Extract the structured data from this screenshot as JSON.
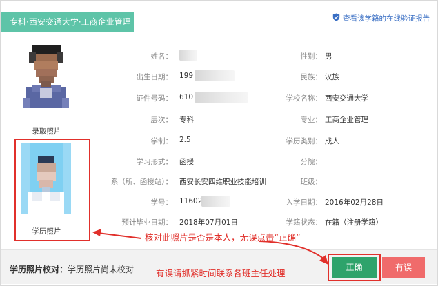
{
  "header": {
    "title": "专科·西安交通大学·工商企业管理",
    "verify_link": "查看该学籍的在线验证报告",
    "link_color": "#3a6fc4",
    "accent_color": "#5ec4a8"
  },
  "photos": {
    "admission_caption": "录取照片",
    "degree_caption": "学历照片"
  },
  "left_fields": [
    {
      "label": "姓名：",
      "value": ""
    },
    {
      "label": "出生日期：",
      "value": "199"
    },
    {
      "label": "证件号码：",
      "value": "610"
    },
    {
      "label": "层次：",
      "value": "专科"
    },
    {
      "label": "学制：",
      "value": "2.5"
    },
    {
      "label": "学习形式：",
      "value": "函授"
    },
    {
      "label": "系（所、函授站）：",
      "value": "西安长安四维职业技能培训"
    },
    {
      "label": "学号：",
      "value": "11602"
    },
    {
      "label": "预计毕业日期：",
      "value": "2018年07月01日"
    }
  ],
  "right_fields": [
    {
      "label": "性别：",
      "value": "男"
    },
    {
      "label": "民族：",
      "value": "汉族"
    },
    {
      "label": "学校名称：",
      "value": "西安交通大学"
    },
    {
      "label": "专业：",
      "value": "工商企业管理"
    },
    {
      "label": "学历类别：",
      "value": "成人"
    },
    {
      "label": "分院：",
      "value": ""
    },
    {
      "label": "班级：",
      "value": ""
    },
    {
      "label": "入学日期：",
      "value": "2016年02月28日"
    },
    {
      "label": "学籍状态：",
      "value": "在籍（注册学籍）"
    }
  ],
  "verification": {
    "label": "学历照片校对：",
    "status": "学历照片尚未校对"
  },
  "annotations": {
    "check_photo": "核对此照片是否是本人，无误点击“正确”",
    "contact": "有误请抓紧时间联系各班主任处理",
    "color": "#e1302b"
  },
  "buttons": {
    "correct": "正确",
    "wrong": "有误"
  }
}
